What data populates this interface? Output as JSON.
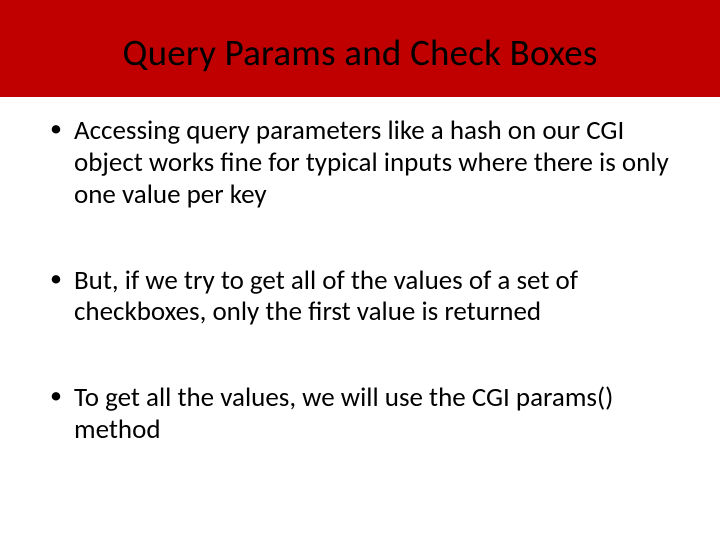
{
  "title": "Query Params and Check Boxes",
  "bullets": [
    "Accessing query parameters like a hash on our CGI object works fine for typical inputs where there is only one value per key",
    "But, if we try to get all of the values of a set of checkboxes, only the first value is returned",
    "To get all the values, we will use the CGI params() method"
  ]
}
